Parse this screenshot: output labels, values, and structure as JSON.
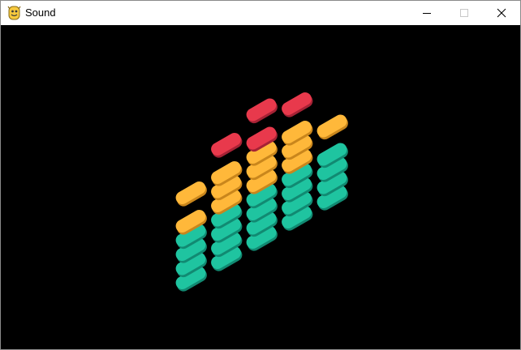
{
  "window": {
    "title": "Sound",
    "app_icon": "python-icon",
    "controls": {
      "minimize_icon": "minimize-icon",
      "maximize_icon": "maximize-icon",
      "close_icon": "close-icon"
    }
  },
  "equalizer": {
    "colors": {
      "teal": "#1fc4a0",
      "yellow": "#ffb83a",
      "red": "#e8394c"
    },
    "columns": [
      {
        "levels": [
          {
            "color": "teal"
          },
          {
            "color": "teal"
          },
          {
            "color": "teal"
          },
          {
            "color": "teal"
          },
          {
            "color": "yellow"
          },
          {
            "color": "none"
          },
          {
            "color": "yellow"
          }
        ]
      },
      {
        "levels": [
          {
            "color": "teal"
          },
          {
            "color": "teal"
          },
          {
            "color": "teal"
          },
          {
            "color": "teal"
          },
          {
            "color": "yellow"
          },
          {
            "color": "yellow"
          },
          {
            "color": "yellow"
          },
          {
            "color": "none"
          },
          {
            "color": "red"
          }
        ]
      },
      {
        "levels": [
          {
            "color": "teal"
          },
          {
            "color": "teal"
          },
          {
            "color": "teal"
          },
          {
            "color": "teal"
          },
          {
            "color": "yellow"
          },
          {
            "color": "yellow"
          },
          {
            "color": "yellow"
          },
          {
            "color": "red"
          },
          {
            "color": "none"
          },
          {
            "color": "red"
          }
        ]
      },
      {
        "levels": [
          {
            "color": "teal"
          },
          {
            "color": "teal"
          },
          {
            "color": "teal"
          },
          {
            "color": "teal"
          },
          {
            "color": "yellow"
          },
          {
            "color": "yellow"
          },
          {
            "color": "yellow"
          },
          {
            "color": "none"
          },
          {
            "color": "red"
          }
        ]
      },
      {
        "levels": [
          {
            "color": "teal"
          },
          {
            "color": "teal"
          },
          {
            "color": "teal"
          },
          {
            "color": "teal"
          },
          {
            "color": "none"
          },
          {
            "color": "yellow"
          }
        ]
      }
    ]
  }
}
